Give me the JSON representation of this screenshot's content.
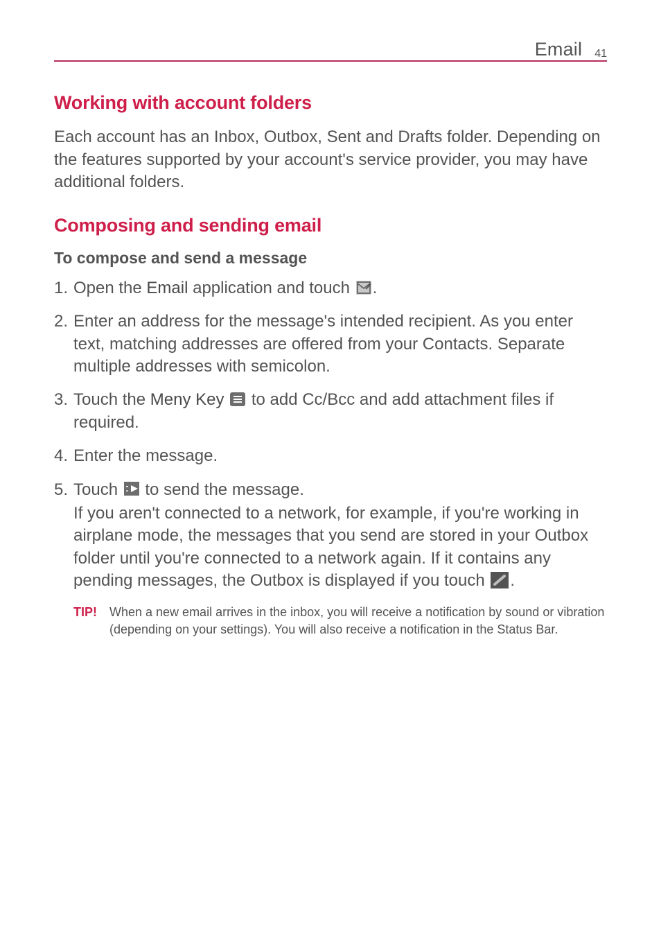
{
  "header": {
    "section": "Email",
    "page_number": "41"
  },
  "sections": {
    "working_folders": {
      "title": "Working with account folders",
      "body": "Each account has an Inbox, Outbox, Sent and Drafts folder. Depending on the features supported by your account's service provider, you may have additional folders."
    },
    "composing": {
      "title": "Composing and sending email",
      "subhead": "To compose and send a message",
      "steps": {
        "s1a": "Open the ",
        "s1b": "Email",
        "s1c": " application and touch ",
        "s1d": ".",
        "s2": "Enter an address for the message's intended recipient. As you enter text, matching addresses are offered from your Contacts. Separate multiple addresses with semicolon.",
        "s3a": "Touch the ",
        "s3b": "Meny Key",
        "s3c": " to add Cc/Bcc and add attachment files if required.",
        "s4": "Enter the message.",
        "s5a": "Touch ",
        "s5b": " to send the message.",
        "s5c": "If you aren't connected to a network, for example, if you're working in airplane mode, the messages that you send are stored in your Outbox folder until you're connected to a network again. If it contains any pending messages, the Outbox is displayed if you touch ",
        "s5d": "."
      }
    },
    "tip": {
      "label": "TIP!",
      "body": "When a new email arrives in the inbox, you will receive a notification by sound or vibration (depending on your settings). You will also receive a notification in the Status Bar."
    }
  }
}
